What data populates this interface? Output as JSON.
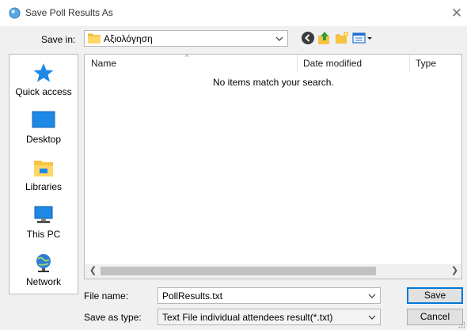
{
  "window": {
    "title": "Save Poll Results As",
    "close_icon": "close-icon",
    "app_icon": "app-circle-icon"
  },
  "toolbar": {
    "save_in_label": "Save in:",
    "save_in_value": "Αξιολόγηση",
    "icons": [
      "back-icon",
      "up-folder-icon",
      "new-folder-icon",
      "view-menu-icon"
    ]
  },
  "places": [
    {
      "label": "Quick access",
      "icon": "quick-access-star-icon"
    },
    {
      "label": "Desktop",
      "icon": "desktop-icon"
    },
    {
      "label": "Libraries",
      "icon": "libraries-icon"
    },
    {
      "label": "This PC",
      "icon": "this-pc-icon"
    },
    {
      "label": "Network",
      "icon": "network-icon"
    }
  ],
  "file_list": {
    "columns": [
      "Name",
      "Date modified",
      "Type"
    ],
    "empty_message": "No items match your search."
  },
  "form": {
    "file_name_label": "File name:",
    "file_name_value": "PollResults.txt",
    "save_as_type_label": "Save as type:",
    "save_as_type_value": "Text File individual attendees result(*.txt)"
  },
  "buttons": {
    "save": "Save",
    "cancel": "Cancel"
  },
  "colors": {
    "accent": "#0078d7",
    "folder": "#f6c343",
    "blue_icon": "#1e88e5"
  }
}
